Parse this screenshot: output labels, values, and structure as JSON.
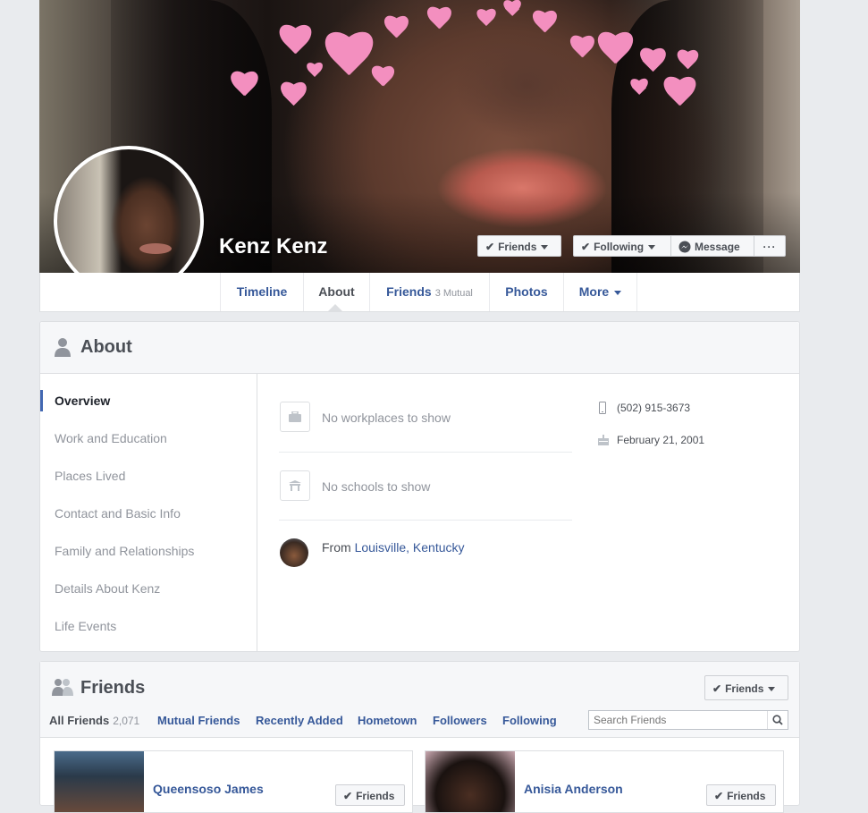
{
  "profile": {
    "name": "Kenz Kenz",
    "actions": {
      "friends_label": "Friends",
      "following_label": "Following",
      "message_label": "Message",
      "more_label": "···"
    }
  },
  "nav": {
    "tabs": [
      {
        "label": "Timeline"
      },
      {
        "label": "About"
      },
      {
        "label": "Friends",
        "sub": "3 Mutual"
      },
      {
        "label": "Photos"
      },
      {
        "label": "More"
      }
    ]
  },
  "about": {
    "title": "About",
    "sidebar": [
      "Overview",
      "Work and Education",
      "Places Lived",
      "Contact and Basic Info",
      "Family and Relationships",
      "Details About Kenz",
      "Life Events"
    ],
    "overview": {
      "work": "No workplaces to show",
      "school": "No schools to show",
      "from_prefix": "From",
      "from_place": "Louisville, Kentucky"
    },
    "contact": {
      "phone": "(502) 915-3673",
      "birthday": "February 21, 2001"
    }
  },
  "friends": {
    "title": "Friends",
    "button_label": "Friends",
    "tabs": [
      {
        "label": "All Friends",
        "count": "2,071"
      },
      {
        "label": "Mutual Friends"
      },
      {
        "label": "Recently Added"
      },
      {
        "label": "Hometown"
      },
      {
        "label": "Followers"
      },
      {
        "label": "Following"
      }
    ],
    "search_placeholder": "Search Friends",
    "list": [
      {
        "name": "Queensoso James",
        "button_label": "Friends"
      },
      {
        "name": "Anisia Anderson",
        "button_label": "Friends"
      }
    ]
  },
  "colors": {
    "link": "#365899",
    "accent": "#4267b2",
    "heart": "#f38fbf"
  }
}
